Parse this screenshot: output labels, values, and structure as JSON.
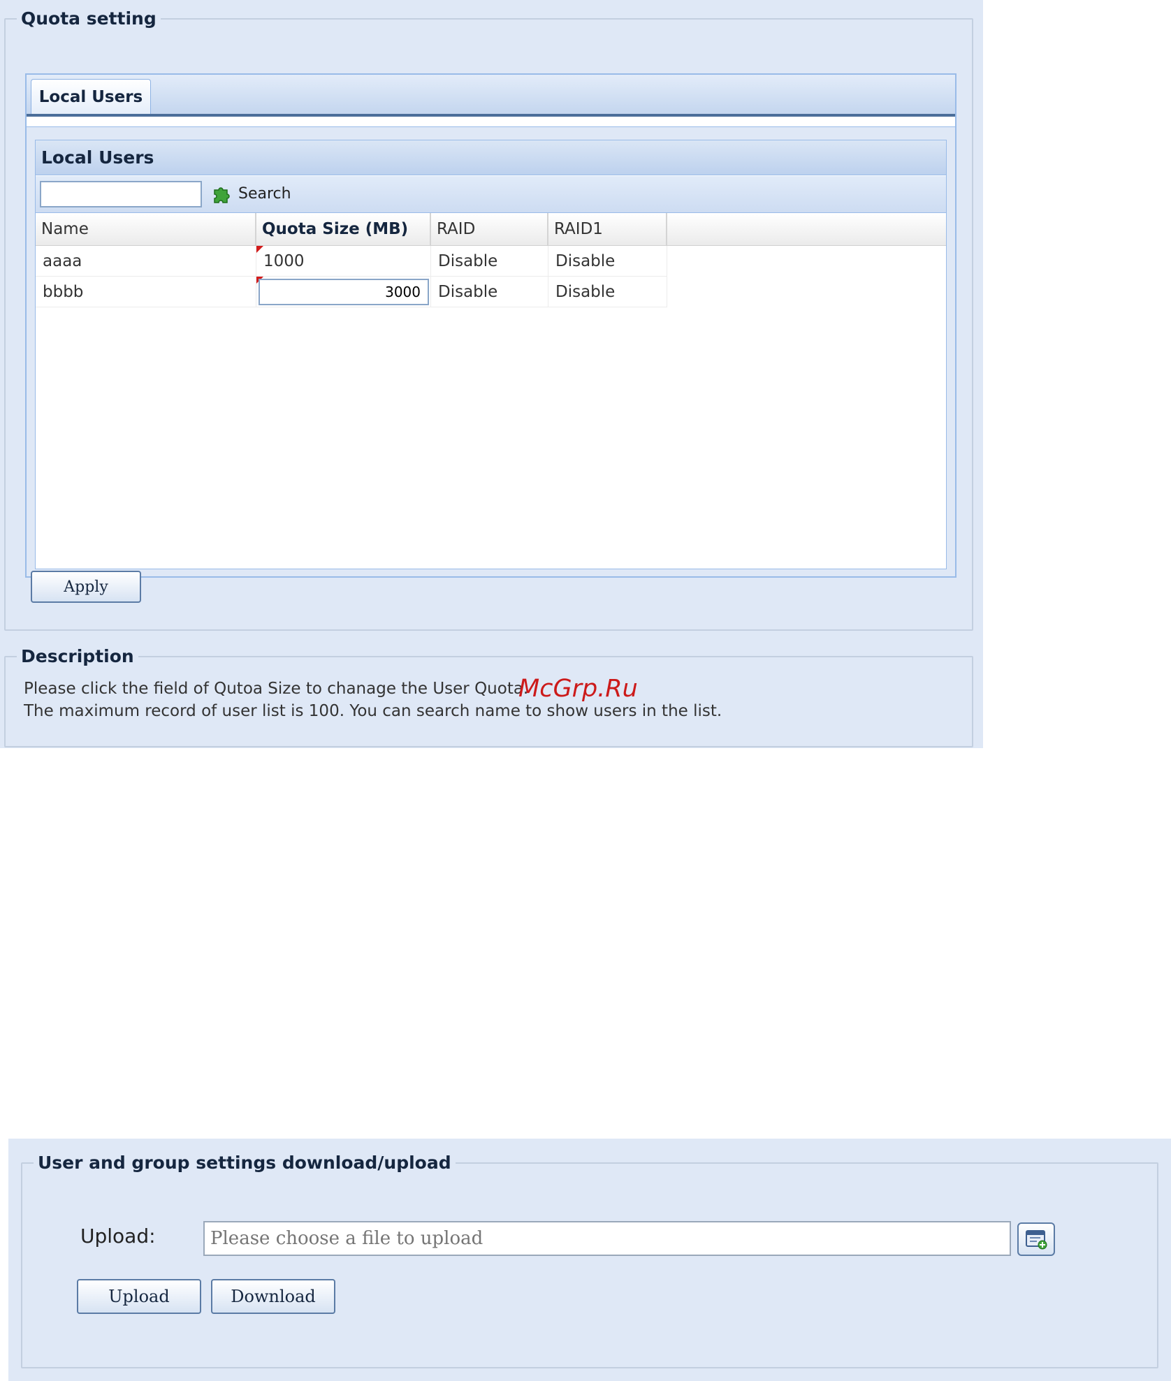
{
  "quota": {
    "legend": "Quota setting",
    "tab_label": "Local Users",
    "grid_title": "Local Users",
    "search": {
      "value": "",
      "placeholder": "",
      "button_label": "Search",
      "icon": "puzzle-search-icon"
    },
    "columns": [
      "Name",
      "Quota Size (MB)",
      "RAID",
      "RAID1"
    ],
    "rows": [
      {
        "name": "aaaa",
        "quota": "1000",
        "raid": "Disable",
        "raid1": "Disable",
        "modified": true
      },
      {
        "name": "bbbb",
        "quota": "3000",
        "raid": "Disable",
        "raid1": "Disable",
        "modified": true,
        "editing": true
      }
    ],
    "apply_label": "Apply"
  },
  "description": {
    "legend": "Description",
    "line1": "Please click the field of Qutoa Size to chanage the User Quota.",
    "line2": "The maximum record of user list is 100. You can search name to show users in the list."
  },
  "watermark": "McGrp.Ru",
  "transfer": {
    "legend": "User and group settings download/upload",
    "upload_label": "Upload:",
    "file_placeholder": "Please choose a file to upload",
    "browse_icon": "browse-file-icon",
    "upload_button": "Upload",
    "download_button": "Download"
  },
  "colors": {
    "panel_bg": "#dfe8f6",
    "border_blue": "#99bbe8",
    "dirty_marker": "#d21a1a",
    "watermark": "#cc1a1a"
  }
}
